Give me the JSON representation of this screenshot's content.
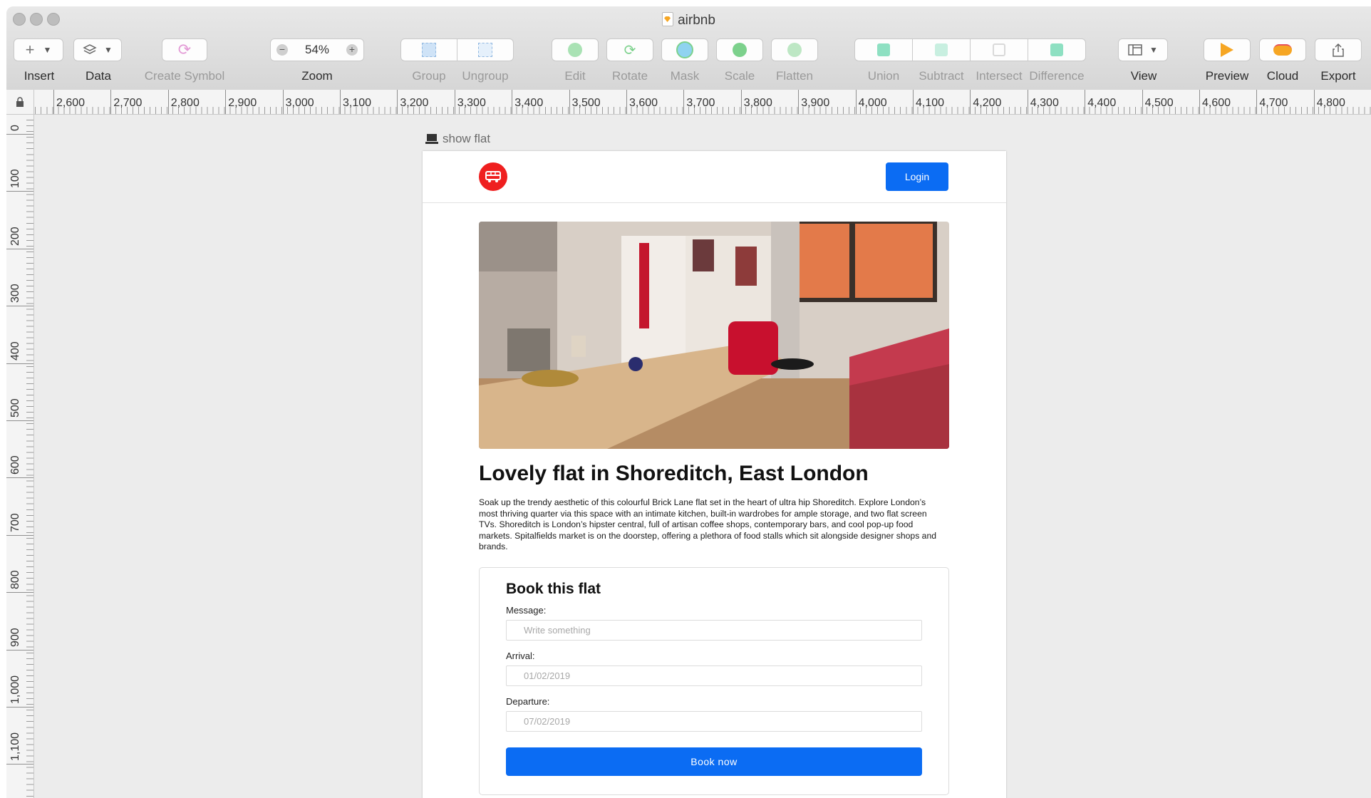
{
  "window": {
    "title": "airbnb"
  },
  "toolbar": {
    "insert_label": "Insert",
    "data_label": "Data",
    "create_symbol_label": "Create Symbol",
    "zoom_label": "Zoom",
    "zoom_value": "54%",
    "group_label": "Group",
    "ungroup_label": "Ungroup",
    "edit_label": "Edit",
    "rotate_label": "Rotate",
    "mask_label": "Mask",
    "scale_label": "Scale",
    "flatten_label": "Flatten",
    "union_label": "Union",
    "subtract_label": "Subtract",
    "intersect_label": "Intersect",
    "difference_label": "Difference",
    "view_label": "View",
    "preview_label": "Preview",
    "cloud_label": "Cloud",
    "export_label": "Export"
  },
  "ruler": {
    "horizontal": [
      "2,600",
      "2,700",
      "2,800",
      "2,900",
      "3,000",
      "3,100",
      "3,200",
      "3,300",
      "3,400",
      "3,500",
      "3,600",
      "3,700",
      "3,800",
      "3,900",
      "4,000",
      "4,100",
      "4,200",
      "4,300",
      "4,400",
      "4,500",
      "4,600",
      "4,700",
      "4,800"
    ],
    "vertical": [
      "0",
      "100",
      "200",
      "300",
      "400",
      "500",
      "600",
      "700",
      "800",
      "900",
      "1,000",
      "1,100"
    ]
  },
  "artboard": {
    "name": "show flat",
    "login_label": "Login",
    "listing_title": "Lovely flat in Shoreditch, East London",
    "listing_description": "Soak up the trendy aesthetic of this colourful Brick Lane flat set in the heart of ultra hip Shoreditch. Explore London’s most thriving quarter via this space with an intimate kitchen, built-in wardrobes for ample storage, and two flat screen TVs. Shoreditch is London’s hipster central, full of artisan coffee shops, contemporary bars, and cool pop-up food markets. Spitalfields market is on the doorstep, offering a plethora of food stalls which sit alongside designer shops and brands.",
    "booking": {
      "title": "Book this flat",
      "message_label": "Message:",
      "message_placeholder": "Write something",
      "arrival_label": "Arrival:",
      "arrival_placeholder": "01/02/2019",
      "departure_label": "Departure:",
      "departure_placeholder": "07/02/2019",
      "submit_label": "Book now"
    }
  },
  "colors": {
    "accent_blue": "#0b6cf3",
    "logo_red": "#ef1f1f"
  }
}
